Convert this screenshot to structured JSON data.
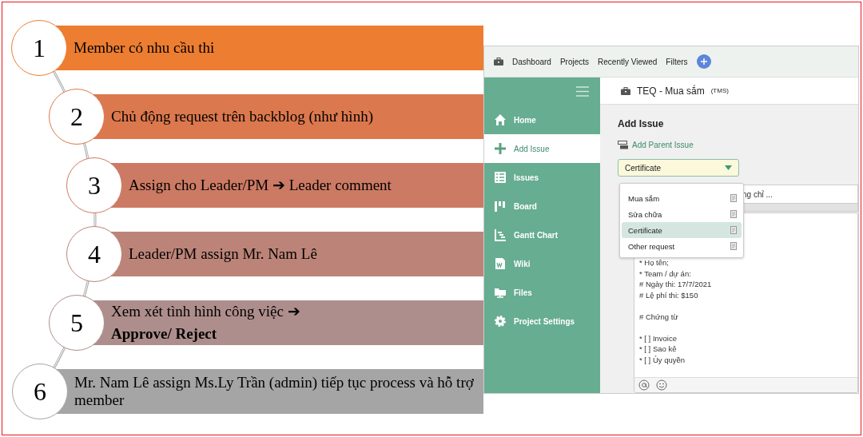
{
  "steps": [
    {
      "number": "1",
      "text": "Member có nhu cầu thi",
      "color": "#ed7d31"
    },
    {
      "number": "2",
      "text": "Chủ động request trên backblog (như hình)",
      "color": "#dc784d"
    },
    {
      "number": "3",
      "text": "Assign cho Leader/PM ➔ Leader comment",
      "color": "#cc7a64"
    },
    {
      "number": "4",
      "text": "Leader/PM assign Mr. Nam Lê",
      "color": "#bc8478"
    },
    {
      "number": "5",
      "text": "Xem xét tình hình công việc ➔ **Approve/ Reject**",
      "color": "#ae8e8c"
    },
    {
      "number": "6",
      "text": "Mr. Nam Lê assign Ms.Ly Trần (admin) tiếp tục process và hỗ trợ member",
      "color": "#a5a5a5"
    }
  ],
  "app": {
    "top_nav": [
      "Dashboard",
      "Projects",
      "Recently Viewed",
      "Filters"
    ],
    "sidebar": {
      "items": [
        {
          "label": "Home",
          "selected": false
        },
        {
          "label": "Add Issue",
          "selected": true
        },
        {
          "label": "Issues",
          "selected": false
        },
        {
          "label": "Board",
          "selected": false
        },
        {
          "label": "Gantt Chart",
          "selected": false
        },
        {
          "label": "Wiki",
          "selected": false
        },
        {
          "label": "Files",
          "selected": false
        },
        {
          "label": "Project Settings",
          "selected": false
        }
      ]
    },
    "project": {
      "name": "TEQ - Mua sắm",
      "key": "(TMS)"
    },
    "heading": "Add Issue",
    "parent_link": "Add Parent Issue",
    "issue_type": {
      "value": "Certificate",
      "options": [
        {
          "label": "Mua sắm",
          "selected": false
        },
        {
          "label": "Sửa chữa",
          "selected": false
        },
        {
          "label": "Certificate",
          "selected": true
        },
        {
          "label": "Other request",
          "selected": false
        }
      ]
    },
    "subject": "ng chỉ ...",
    "description": [
      [
        "* Họ tên;",
        "* Team / dự án:",
        "# Ngày thi: 17/7/2021",
        "# Lệ phí thi: $150"
      ],
      [
        "# Chứng từ"
      ],
      [
        "* [ ] Invoice",
        "* [ ] Sao kê",
        "* [ ] Ủy quyền"
      ]
    ]
  }
}
